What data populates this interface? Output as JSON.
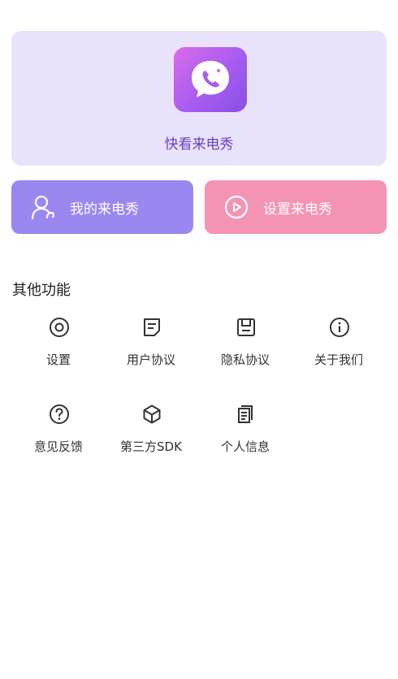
{
  "app": {
    "name": "快看来电秀"
  },
  "actions": {
    "my_shows_label": "我的来电秀",
    "set_show_label": "设置来电秀"
  },
  "section": {
    "title": "其他功能"
  },
  "features": [
    {
      "label": "设置",
      "icon": "settings-icon"
    },
    {
      "label": "用户协议",
      "icon": "document-icon"
    },
    {
      "label": "隐私协议",
      "icon": "save-icon"
    },
    {
      "label": "关于我们",
      "icon": "info-icon"
    },
    {
      "label": "意见反馈",
      "icon": "question-icon"
    },
    {
      "label": "第三方SDK",
      "icon": "cube-icon"
    },
    {
      "label": "个人信息",
      "icon": "copy-document-icon"
    }
  ],
  "colors": {
    "hero_bg": "#e8e3fb",
    "primary_button": "#9a87f0",
    "secondary_button": "#f394b4",
    "accent_text": "#6b3fc2"
  }
}
